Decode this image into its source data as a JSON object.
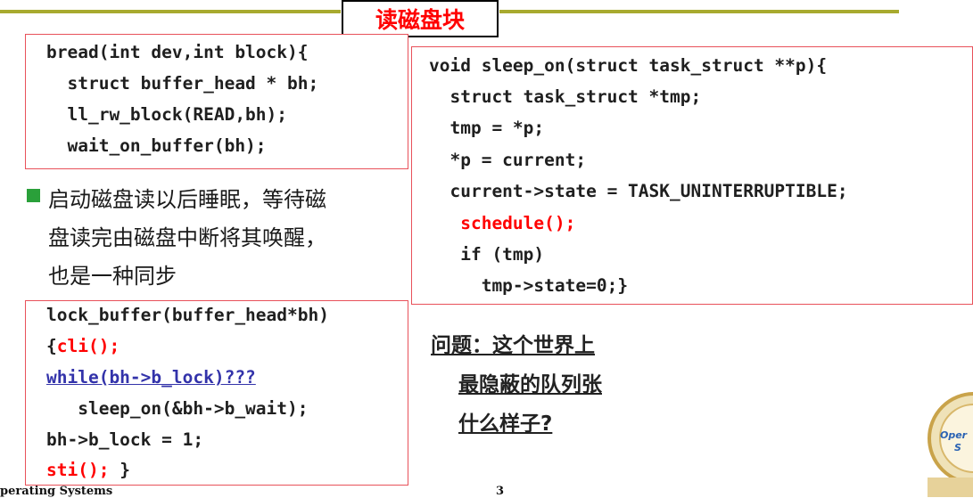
{
  "title": "读磁盘块",
  "bread_code": [
    "bread(int dev,int block){",
    "  struct buffer_head * bh;",
    "  ll_rw_block(READ,bh);",
    "  wait_on_buffer(bh);"
  ],
  "bullet_text": [
    "启动磁盘读以后睡眠，等待磁",
    "盘读完由磁盘中断将其唤醒，",
    "也是一种同步"
  ],
  "sleep_on_code": [
    "void sleep_on(struct task_struct **p){",
    "  struct task_struct *tmp;",
    "  tmp = *p;",
    "  *p = current;",
    "  current->state = TASK_UNINTERRUPTIBLE;",
    "   schedule();",
    "   if (tmp)",
    "     tmp->state=0;}"
  ],
  "lock_code": {
    "line1": "lock_buffer(buffer_head*bh)",
    "line2_brace": "{",
    "line2_cli": "cli();",
    "line3": "while(bh->b_lock)???",
    "line4": "   sleep_on(&bh->b_wait);",
    "line5": "bh->b_lock = 1;",
    "line6_sti": "sti();",
    "line6_brace": " }"
  },
  "question": [
    "问题：这个世界上",
    "最隐蔽的队列张",
    "什么样子?"
  ],
  "footer": {
    "course": "perating Systems",
    "page": "3"
  },
  "logo": {
    "text": "Oper S"
  },
  "colors": {
    "accent_line": "#a8aa2f",
    "box_border": "#e8515a",
    "title_red": "#ff0000",
    "bullet_green": "#2aa03a"
  }
}
